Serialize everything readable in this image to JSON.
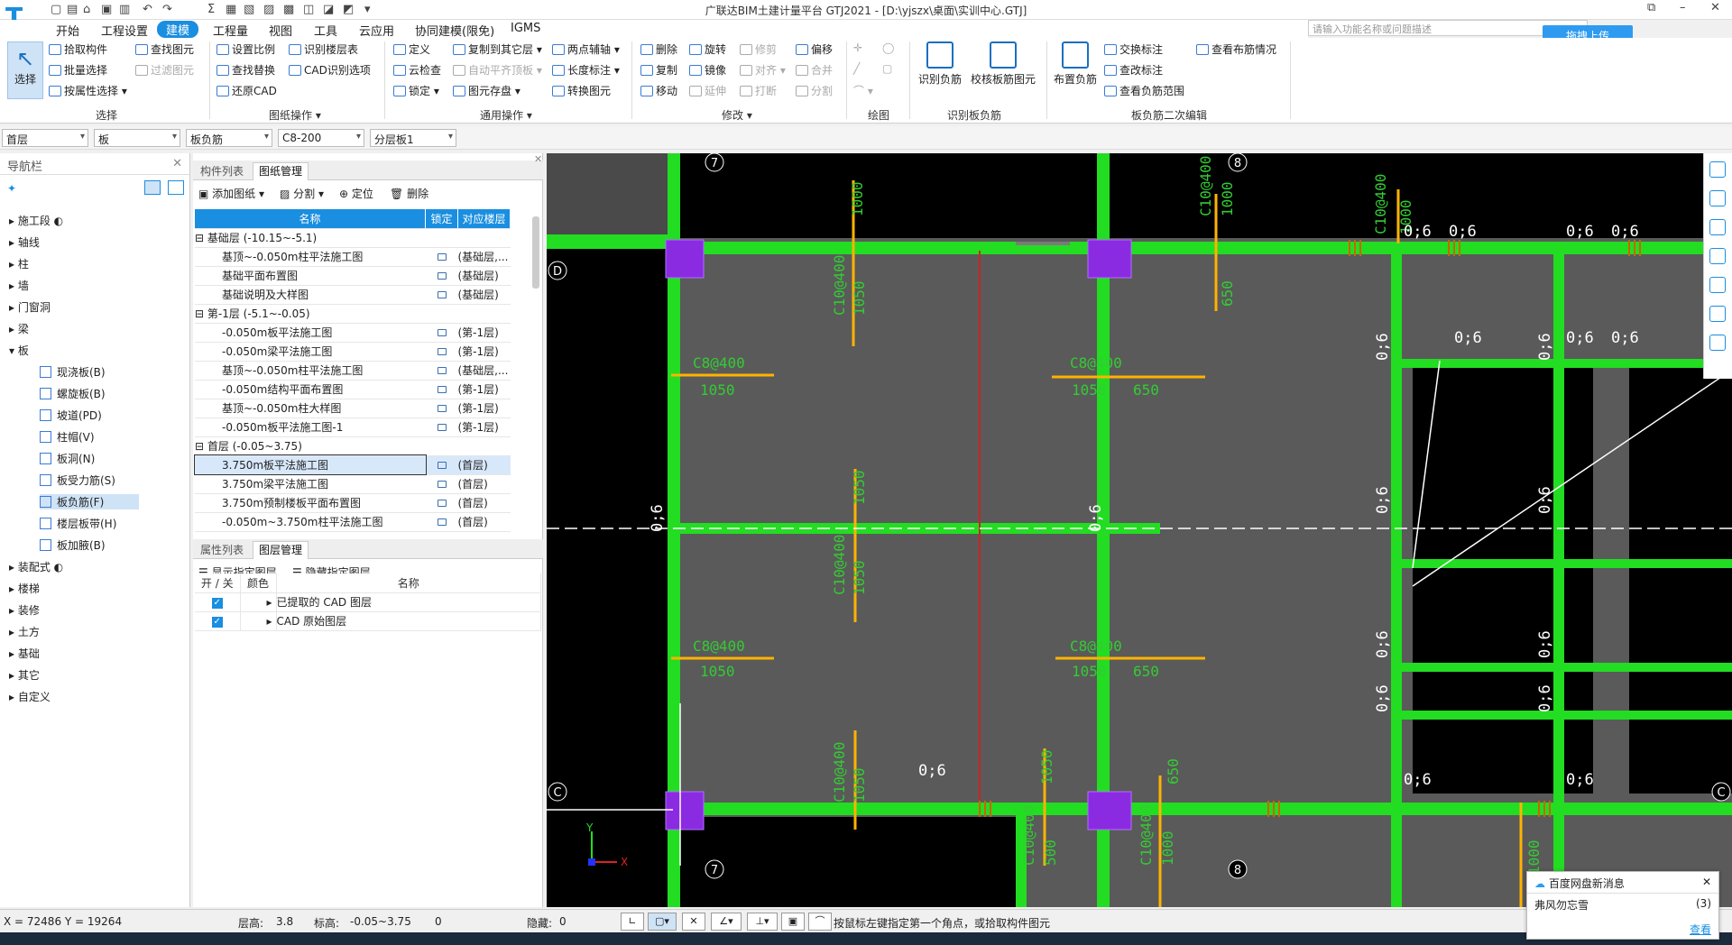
{
  "title": "广联达BIM土建计量平台 GTJ2021 - [D:\\yjszx\\桌面\\实训中心.GTJ]",
  "search_placeholder": "请输入功能名称或问题描述",
  "upload_label": "拖拽上传",
  "menus": [
    "开始",
    "工程设置",
    "建模",
    "工程量",
    "视图",
    "工具",
    "云应用",
    "协同建模(限免)",
    "IGMS"
  ],
  "ribbon": {
    "select": "选择",
    "pick": "拾取构件",
    "batch": "批量选择",
    "byattr": "按属性选择",
    "find": "查找图元",
    "filter": "过滤图元",
    "g_select": "选择",
    "scale": "设置比例",
    "replace": "查找替换",
    "restore": "还原CAD",
    "idfloor": "识别楼层表",
    "cadopt": "CAD识别选项",
    "g_drawing": "图纸操作",
    "define": "定义",
    "cloud": "云检查",
    "lock": "锁定",
    "copyto": "复制到其它层",
    "autoflat": "自动平齐顶板",
    "storage": "图元存盘",
    "twopt": "两点辅轴",
    "length": "长度标注",
    "convert": "转换图元",
    "g_common": "通用操作",
    "delete": "删除",
    "copy": "复制",
    "move": "移动",
    "rotate": "旋转",
    "mirror": "镜像",
    "extend": "延伸",
    "trim": "修剪",
    "align": "对齐",
    "break": "打断",
    "offset": "偏移",
    "merge": "合并",
    "split": "分割",
    "g_modify": "修改",
    "g_draw": "绘图",
    "idneg": "识别负筋",
    "checkneg": "校核板筋图元",
    "g_idrebar": "识别板负筋",
    "layout": "布置负筋",
    "swap": "交换标注",
    "viewcheck": "查改标注",
    "viewrange": "查看负筋范围",
    "viewlayout": "查看布筋情况",
    "g_edit2": "板负筋二次编辑"
  },
  "filters": [
    "首层",
    "板",
    "板负筋",
    "C8-200",
    "分层板1"
  ],
  "nav": {
    "title": "导航栏",
    "items": [
      "施工段",
      "轴线",
      "柱",
      "墙",
      "门窗洞",
      "梁",
      "板"
    ],
    "sub": [
      "现浇板(B)",
      "螺旋板(B)",
      "坡道(PD)",
      "柱帽(V)",
      "板洞(N)",
      "板受力筋(S)",
      "板负筋(F)",
      "楼层板带(H)",
      "板加腋(B)"
    ],
    "items2": [
      "装配式",
      "楼梯",
      "装修",
      "土方",
      "基础",
      "其它",
      "自定义"
    ]
  },
  "mid": {
    "tab1": "构件列表",
    "tab2": "图纸管理",
    "add": "添加图纸",
    "split": "分割",
    "locate": "定位",
    "del": "删除",
    "col_name": "名称",
    "col_lock": "锁定",
    "col_floor": "对应楼层",
    "groups": [
      {
        "name": "基础层 (-10.15~-5.1)",
        "rows": [
          [
            "基顶~-0.050m柱平法施工图",
            "(基础层,..."
          ],
          [
            "基础平面布置图",
            "(基础层)"
          ],
          [
            "基础说明及大样图",
            "(基础层)"
          ]
        ]
      },
      {
        "name": "第-1层 (-5.1~-0.05)",
        "rows": [
          [
            "-0.050m板平法施工图",
            "(第-1层)"
          ],
          [
            "-0.050m梁平法施工图",
            "(第-1层)"
          ],
          [
            "基顶~-0.050m柱平法施工图",
            "(基础层,..."
          ],
          [
            "-0.050m结构平面布置图",
            "(第-1层)"
          ],
          [
            "基顶~-0.050m柱大样图",
            "(第-1层)"
          ],
          [
            "-0.050m板平法施工图-1",
            "(第-1层)"
          ]
        ]
      },
      {
        "name": "首层 (-0.05~3.75)",
        "rows": [
          [
            "3.750m板平法施工图",
            "(首层)"
          ],
          [
            "3.750m梁平法施工图",
            "(首层)"
          ],
          [
            "3.750m预制楼板平面布置图",
            "(首层)"
          ],
          [
            "-0.050m~3.750m柱平法施工图",
            "(首层)"
          ]
        ]
      }
    ],
    "tab3": "属性列表",
    "tab4": "图层管理",
    "show": "显示指定图层",
    "hide": "隐藏指定图层",
    "l_onoff": "开 / 关",
    "l_color": "颜色",
    "l_name": "名称",
    "layers": [
      "已提取的 CAD 图层",
      "CAD 原始图层"
    ]
  },
  "status": {
    "coords": "X = 72486 Y = 19264",
    "height_l": "层高:",
    "height_v": "3.8",
    "elev_l": "标高:",
    "elev_v": "-0.05~3.75",
    "zero": "0",
    "hidden_l": "隐藏:",
    "hidden_v": "0",
    "hint": "按鼠标左键指定第一个角点，或拾取构件图元"
  },
  "notify": {
    "title": "百度网盘新消息",
    "msg": "弗风勿忘雪",
    "count": "(3)",
    "view": "查看"
  },
  "canvas_labels": {
    "axis7": "7",
    "axis8": "8",
    "axisD": "D",
    "axisC": "C",
    "rebar": [
      "C10@400",
      "C8@400",
      "1000",
      "1050",
      "650",
      "500",
      "0;6"
    ],
    "ucs_y": "Y",
    "ucs_x": "X"
  },
  "colors": {
    "accent": "#1a8ee0",
    "beam": "#22dd22",
    "column": "#8a2be2",
    "rebar": "#ffb300",
    "text": "#33cc33"
  }
}
